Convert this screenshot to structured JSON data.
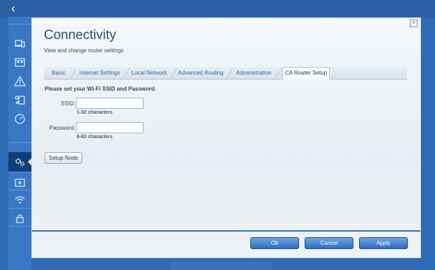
{
  "nav": {
    "back_label": "‹"
  },
  "sidebar": {
    "items": [
      {
        "icon": "devices-icon"
      },
      {
        "icon": "map-icon"
      },
      {
        "icon": "warning-icon"
      },
      {
        "icon": "media-icon"
      },
      {
        "icon": "speed-icon"
      },
      {
        "icon": "gear-icon",
        "active": true
      },
      {
        "icon": "plus-box-icon"
      },
      {
        "icon": "wifi-icon"
      },
      {
        "icon": "lock-icon"
      }
    ]
  },
  "panel": {
    "close_label": "×",
    "title": "Connectivity",
    "subtitle": "View and change router settings",
    "tabs": [
      {
        "label": "Basic"
      },
      {
        "label": "Internet Settings"
      },
      {
        "label": "Local Network"
      },
      {
        "label": "Advanced Routing"
      },
      {
        "label": "Administration"
      },
      {
        "label": "CA Router Setup",
        "active": true
      }
    ],
    "prompt": "Please set your Wi-Fi SSID and Password.",
    "ssid": {
      "label": "SSID:",
      "value": "",
      "hint": "1-32 characters"
    },
    "password": {
      "label": "Password:",
      "value": "",
      "hint": "8-63 characters"
    },
    "setup_node_label": "Setup Node",
    "buttons": {
      "ok": "Ok",
      "cancel": "Cancel",
      "apply": "Apply"
    }
  },
  "colors": {
    "background": "#2d6bb6",
    "sidebar": "#3a78c5",
    "sidebar_active": "#0f3f78",
    "link_tab": "#2d6aa8",
    "primary_button": "#2f6cbf"
  }
}
